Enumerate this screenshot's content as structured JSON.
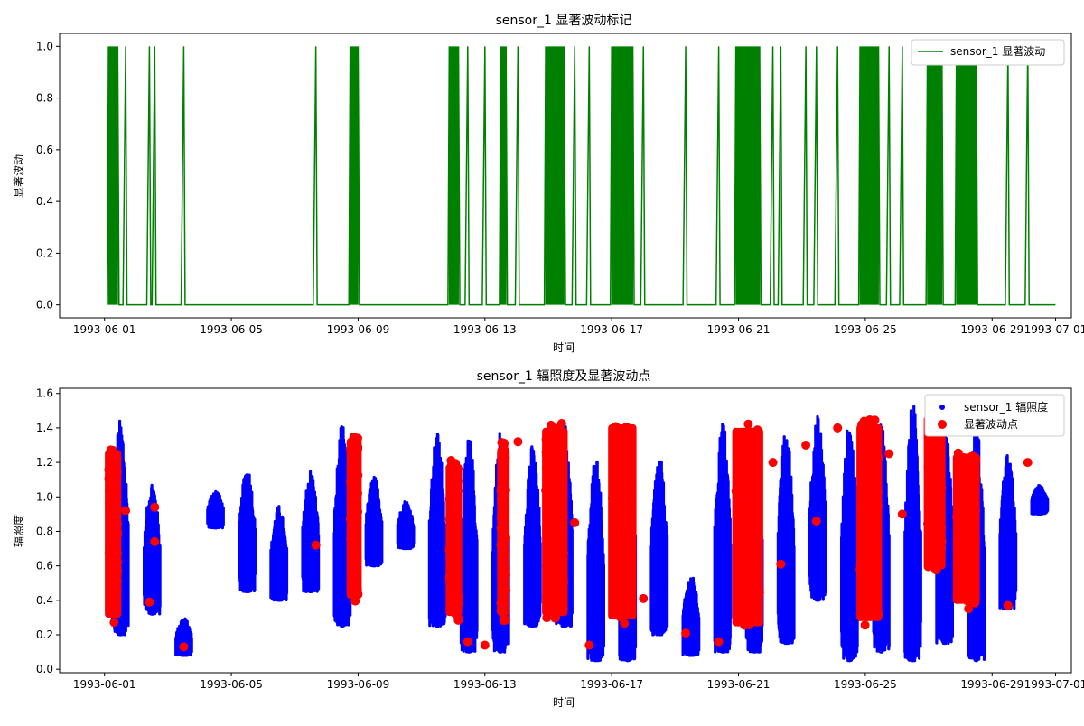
{
  "chart_data": [
    {
      "type": "line",
      "title": "sensor_1 显著波动标记",
      "xlabel": "时间",
      "ylabel": "显著波动",
      "xlim": [
        "1993-05-30T14:00",
        "1993-07-01T12:00"
      ],
      "ylim": [
        -0.05,
        1.05
      ],
      "x_ticks": [
        "1993-06-01",
        "1993-06-05",
        "1993-06-09",
        "1993-06-13",
        "1993-06-17",
        "1993-06-21",
        "1993-06-25",
        "1993-06-29",
        "1993-07-01"
      ],
      "y_ticks": [
        "0.0",
        "0.2",
        "0.4",
        "0.6",
        "0.8",
        "1.0"
      ],
      "legend_position": "top-right",
      "grid": false,
      "series": [
        {
          "name": "sensor_1 显著波动",
          "color": "#008000",
          "dense_bursts": [
            [
              "1993-06-01T03:00",
              "1993-06-01T10:00"
            ],
            [
              "1993-06-08T18:00",
              "1993-06-09T00:00"
            ],
            [
              "1993-06-11T21:00",
              "1993-06-12T04:00"
            ],
            [
              "1993-06-13T12:00",
              "1993-06-13T16:00"
            ],
            [
              "1993-06-14T22:00",
              "1993-06-15T12:00"
            ],
            [
              "1993-06-17T00:00",
              "1993-06-17T16:00"
            ],
            [
              "1993-06-20T22:00",
              "1993-06-21T16:00"
            ],
            [
              "1993-06-24T20:00",
              "1993-06-25T10:00"
            ],
            [
              "1993-06-26T23:00",
              "1993-06-27T10:00"
            ],
            [
              "1993-06-27T21:00",
              "1993-06-28T12:00"
            ]
          ],
          "spikes": [
            "1993-06-01T16:00",
            "1993-06-02T10:00",
            "1993-06-02T14:00",
            "1993-06-03T12:00",
            "1993-06-07T16:00",
            "1993-06-12T11:00",
            "1993-06-13T00:00",
            "1993-06-14T01:00",
            "1993-06-15T20:00",
            "1993-06-16T07:00",
            "1993-06-18T00:00",
            "1993-06-19T08:00",
            "1993-06-20T09:00",
            "1993-06-22T02:00",
            "1993-06-22T08:00",
            "1993-06-23T03:00",
            "1993-06-23T11:00",
            "1993-06-24T03:00",
            "1993-06-25T18:00",
            "1993-06-26T04:00",
            "1993-06-29T12:00",
            "1993-06-30T03:00"
          ]
        }
      ]
    },
    {
      "type": "scatter",
      "title": "sensor_1 辐照度及显著波动点",
      "xlabel": "时间",
      "ylabel": "辐照度",
      "xlim": [
        "1993-05-30T14:00",
        "1993-07-01T12:00"
      ],
      "ylim": [
        -0.02,
        1.63
      ],
      "x_ticks": [
        "1993-06-01",
        "1993-06-05",
        "1993-06-09",
        "1993-06-13",
        "1993-06-17",
        "1993-06-21",
        "1993-06-25",
        "1993-06-29",
        "1993-07-01"
      ],
      "y_ticks": [
        "0.0",
        "0.2",
        "0.4",
        "0.6",
        "0.8",
        "1.0",
        "1.2",
        "1.4",
        "1.6"
      ],
      "legend_position": "top-right",
      "grid": false,
      "series": [
        {
          "name": "sensor_1 辐照度",
          "color": "#0000ff",
          "daily_ranges": [
            {
              "day": "1993-06-01",
              "min": 0.2,
              "max": 1.45
            },
            {
              "day": "1993-06-02",
              "min": 0.32,
              "max": 1.1
            },
            {
              "day": "1993-06-03",
              "min": 0.08,
              "max": 0.3
            },
            {
              "day": "1993-06-04",
              "min": 0.82,
              "max": 1.04
            },
            {
              "day": "1993-06-05",
              "min": 0.45,
              "max": 1.18
            },
            {
              "day": "1993-06-06",
              "min": 0.4,
              "max": 0.95
            },
            {
              "day": "1993-06-07",
              "min": 0.45,
              "max": 1.16
            },
            {
              "day": "1993-06-08",
              "min": 0.25,
              "max": 1.42
            },
            {
              "day": "1993-06-09",
              "min": 0.6,
              "max": 1.12
            },
            {
              "day": "1993-06-10",
              "min": 0.7,
              "max": 0.98
            },
            {
              "day": "1993-06-11",
              "min": 0.25,
              "max": 1.38
            },
            {
              "day": "1993-06-12",
              "min": 0.1,
              "max": 1.35
            },
            {
              "day": "1993-06-13",
              "min": 0.1,
              "max": 1.4
            },
            {
              "day": "1993-06-14",
              "min": 0.25,
              "max": 1.3
            },
            {
              "day": "1993-06-15",
              "min": 0.25,
              "max": 1.44
            },
            {
              "day": "1993-06-16",
              "min": 0.05,
              "max": 1.25
            },
            {
              "day": "1993-06-17",
              "min": 0.05,
              "max": 1.45
            },
            {
              "day": "1993-06-18",
              "min": 0.2,
              "max": 1.25
            },
            {
              "day": "1993-06-19",
              "min": 0.08,
              "max": 0.55
            },
            {
              "day": "1993-06-20",
              "min": 0.1,
              "max": 1.45
            },
            {
              "day": "1993-06-21",
              "min": 0.1,
              "max": 1.35
            },
            {
              "day": "1993-06-22",
              "min": 0.15,
              "max": 1.4
            },
            {
              "day": "1993-06-23",
              "min": 0.4,
              "max": 1.47
            },
            {
              "day": "1993-06-24",
              "min": 0.05,
              "max": 1.45
            },
            {
              "day": "1993-06-25",
              "min": 0.1,
              "max": 1.45
            },
            {
              "day": "1993-06-26",
              "min": 0.05,
              "max": 1.55
            },
            {
              "day": "1993-06-27",
              "min": 0.15,
              "max": 1.5
            },
            {
              "day": "1993-06-28",
              "min": 0.05,
              "max": 1.42
            },
            {
              "day": "1993-06-29",
              "min": 0.35,
              "max": 1.25
            },
            {
              "day": "1993-06-30",
              "min": 0.9,
              "max": 1.07
            }
          ]
        },
        {
          "name": "显著波动点",
          "color": "#ff0000",
          "clusters": [
            {
              "start": "1993-06-01T03:00",
              "end": "1993-06-01T10:00",
              "min": 0.27,
              "max": 1.3
            },
            {
              "start": "1993-06-08T18:00",
              "end": "1993-06-09T00:00",
              "min": 0.38,
              "max": 1.37
            },
            {
              "start": "1993-06-11T21:00",
              "end": "1993-06-12T04:00",
              "min": 0.28,
              "max": 1.22
            },
            {
              "start": "1993-06-13T12:00",
              "end": "1993-06-13T16:00",
              "min": 0.28,
              "max": 1.32
            },
            {
              "start": "1993-06-14T22:00",
              "end": "1993-06-15T12:00",
              "min": 0.28,
              "max": 1.43
            },
            {
              "start": "1993-06-17T00:00",
              "end": "1993-06-17T16:00",
              "min": 0.26,
              "max": 1.45
            },
            {
              "start": "1993-06-20T22:00",
              "end": "1993-06-21T16:00",
              "min": 0.22,
              "max": 1.43
            },
            {
              "start": "1993-06-24T20:00",
              "end": "1993-06-25T10:00",
              "min": 0.25,
              "max": 1.45
            },
            {
              "start": "1993-06-26T23:00",
              "end": "1993-06-27T10:00",
              "min": 0.55,
              "max": 1.5
            },
            {
              "start": "1993-06-27T21:00",
              "end": "1993-06-28T12:00",
              "min": 0.35,
              "max": 1.28
            }
          ],
          "points": [
            {
              "x": "1993-06-01T16:00",
              "y": 0.92
            },
            {
              "x": "1993-06-02T10:00",
              "y": 0.39
            },
            {
              "x": "1993-06-02T14:00",
              "y": 0.74
            },
            {
              "x": "1993-06-02T14:00",
              "y": 0.94
            },
            {
              "x": "1993-06-03T12:00",
              "y": 0.13
            },
            {
              "x": "1993-06-07T16:00",
              "y": 0.72
            },
            {
              "x": "1993-06-12T11:00",
              "y": 0.16
            },
            {
              "x": "1993-06-13T00:00",
              "y": 0.14
            },
            {
              "x": "1993-06-14T01:00",
              "y": 1.32
            },
            {
              "x": "1993-06-15T20:00",
              "y": 0.85
            },
            {
              "x": "1993-06-16T07:00",
              "y": 0.14
            },
            {
              "x": "1993-06-18T00:00",
              "y": 0.41
            },
            {
              "x": "1993-06-19T08:00",
              "y": 0.21
            },
            {
              "x": "1993-06-20T09:00",
              "y": 0.16
            },
            {
              "x": "1993-06-22T02:00",
              "y": 1.2
            },
            {
              "x": "1993-06-22T08:00",
              "y": 0.61
            },
            {
              "x": "1993-06-23T03:00",
              "y": 1.3
            },
            {
              "x": "1993-06-23T11:00",
              "y": 0.86
            },
            {
              "x": "1993-06-24T03:00",
              "y": 1.4
            },
            {
              "x": "1993-06-25T18:00",
              "y": 1.25
            },
            {
              "x": "1993-06-26T04:00",
              "y": 0.9
            },
            {
              "x": "1993-06-29T12:00",
              "y": 0.37
            },
            {
              "x": "1993-06-30T03:00",
              "y": 1.2
            }
          ]
        }
      ]
    }
  ]
}
